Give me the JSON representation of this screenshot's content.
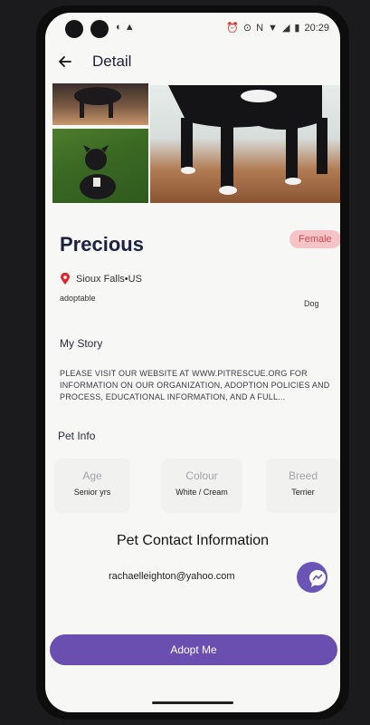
{
  "status_bar": {
    "time": "20:29"
  },
  "app_bar": {
    "title": "Detail"
  },
  "pet": {
    "name": "Precious",
    "gender": "Female",
    "location": "Sioux Falls•US",
    "status": "adoptable",
    "type": "Dog"
  },
  "story": {
    "title": "My Story",
    "text": "PLEASE VISIT OUR WEBSITE AT WWW.PITRESCUE.ORG FOR INFORMATION ON OUR ORGANIZATION, ADOPTION POLICIES AND PROCESS, EDUCATIONAL INFORMATION, AND A FULL..."
  },
  "pet_info": {
    "title": "Pet Info",
    "cards": [
      {
        "label": "Age",
        "value": "Senior yrs"
      },
      {
        "label": "Colour",
        "value": "White / Cream"
      },
      {
        "label": "Breed",
        "value": "Terrier"
      }
    ]
  },
  "contact": {
    "title": "Pet Contact Information",
    "email": "rachaelleighton@yahoo.com"
  },
  "adopt_button": {
    "label": "Adopt Me"
  },
  "colors": {
    "accent": "#6a4fb1",
    "badge_bg": "#f4c4c6",
    "badge_text": "#d34a55"
  },
  "icons": [
    "back-arrow-icon",
    "location-pin-icon",
    "messenger-icon"
  ]
}
